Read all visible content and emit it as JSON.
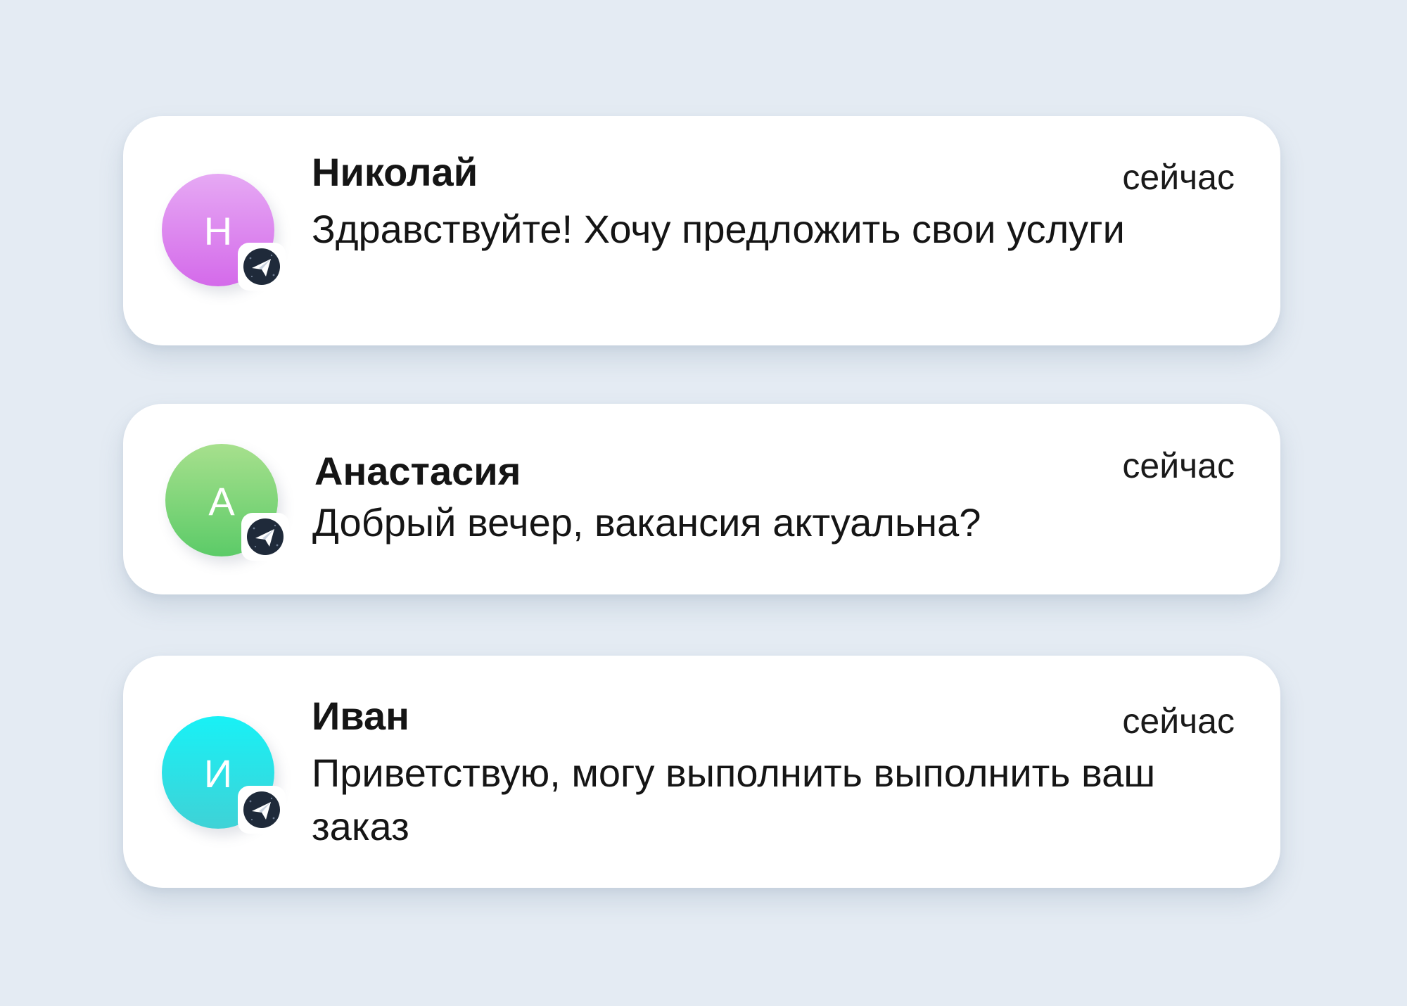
{
  "notifications": [
    {
      "avatar_letter": "Н",
      "sender": "Николай",
      "time": "сейчас",
      "message": "Здравствуйте! Хочу предложить свои услуги",
      "avatar_colors": [
        "#e6a9f4",
        "#d46aea"
      ],
      "badge_icon": "telegram-icon"
    },
    {
      "avatar_letter": "А",
      "sender": "Анастасия",
      "time": "сейчас",
      "message": "Добрый вечер, вакансия актуальна?",
      "avatar_colors": [
        "#a7e08d",
        "#5ccb68"
      ],
      "badge_icon": "telegram-icon"
    },
    {
      "avatar_letter": "И",
      "sender": "Иван",
      "time": "сейчас",
      "message": "Приветствую, могу выполнить выполнить ваш заказ",
      "avatar_colors": [
        "#18f1f6",
        "#3fd2d6"
      ],
      "badge_icon": "telegram-icon"
    }
  ],
  "colors": {
    "background": "#e4ebf3",
    "card": "#ffffff",
    "text": "#151515",
    "badge_fill": "#1f2a3a"
  }
}
